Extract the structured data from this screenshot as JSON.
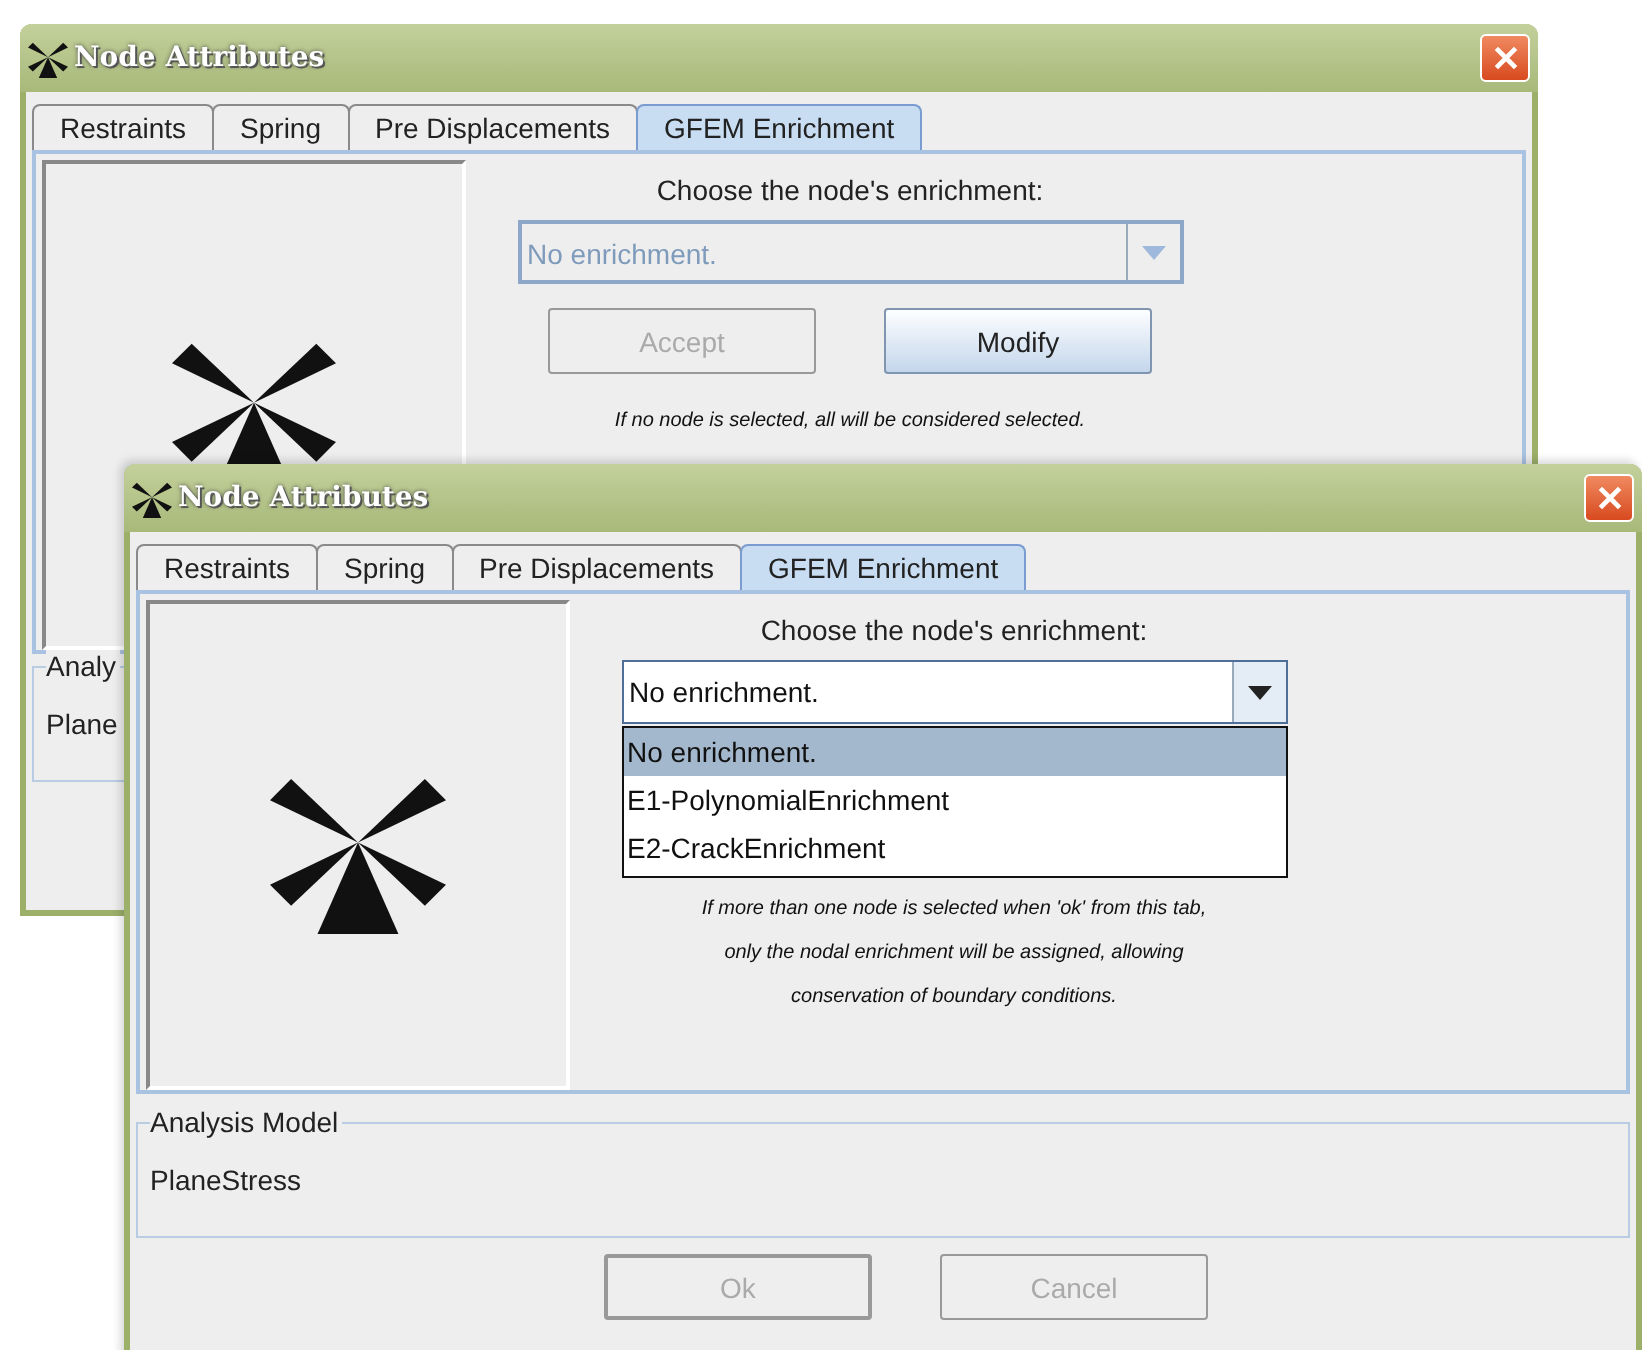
{
  "windows": [
    {
      "title": "Node Attributes",
      "tabs": [
        {
          "label": "Restraints",
          "selected": false
        },
        {
          "label": "Spring",
          "selected": false
        },
        {
          "label": "Pre Displacements",
          "selected": false
        },
        {
          "label": "GFEM Enrichment",
          "selected": true
        }
      ],
      "prompt": "Choose the node's enrichment:",
      "combo": {
        "value": "No enrichment.",
        "disabled": true,
        "expanded": false
      },
      "buttons": [
        {
          "label": "Accept",
          "disabled": true
        },
        {
          "label": "Modify",
          "disabled": false
        }
      ],
      "note": "If no node is selected, all will be considered selected.",
      "analysis": {
        "label": "Analy",
        "value": "Plane"
      }
    },
    {
      "title": "Node Attributes",
      "tabs": [
        {
          "label": "Restraints",
          "selected": false
        },
        {
          "label": "Spring",
          "selected": false
        },
        {
          "label": "Pre Displacements",
          "selected": false
        },
        {
          "label": "GFEM Enrichment",
          "selected": true
        }
      ],
      "prompt": "Choose the node's enrichment:",
      "combo": {
        "value": "No enrichment.",
        "disabled": false,
        "expanded": true,
        "options": [
          {
            "label": "No enrichment.",
            "selected": true
          },
          {
            "label": "E1-PolynomialEnrichment",
            "selected": false
          },
          {
            "label": "E2-CrackEnrichment",
            "selected": false
          }
        ]
      },
      "note": "If more than one node is selected when 'ok' from this tab,\nonly the nodal enrichment will be assigned, allowing\nconservation of boundary conditions.",
      "analysis": {
        "label": "Analysis Model",
        "value": "PlaneStress"
      },
      "footer_buttons": [
        {
          "label": "Ok",
          "disabled": true
        },
        {
          "label": "Cancel",
          "disabled": true
        }
      ]
    }
  ]
}
